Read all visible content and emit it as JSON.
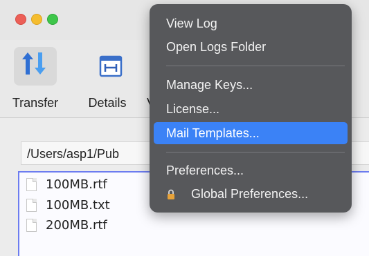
{
  "toolbar": {
    "tools": [
      {
        "label": "Transfer",
        "icon": "transfer-arrows-icon"
      },
      {
        "label": "Details",
        "icon": "details-icon"
      }
    ],
    "cut_label_fragment": "V"
  },
  "path": {
    "value": "/Users/asp1/Pub"
  },
  "files": [
    {
      "name": "100MB.rtf"
    },
    {
      "name": "100MB.txt"
    },
    {
      "name": "200MB.rtf"
    }
  ],
  "menu": {
    "items": [
      {
        "label": "View Log"
      },
      {
        "label": "Open Logs Folder"
      },
      {
        "label": "Manage Keys..."
      },
      {
        "label": "License..."
      },
      {
        "label": "Mail Templates..."
      },
      {
        "label": "Preferences..."
      },
      {
        "label": "Global Preferences...",
        "icon": "lock-icon"
      }
    ],
    "highlighted_index": 4
  },
  "colors": {
    "menu_background": "#57585b",
    "menu_highlight": "#3b82f6",
    "list_focus_border": "#6c7cf0"
  }
}
